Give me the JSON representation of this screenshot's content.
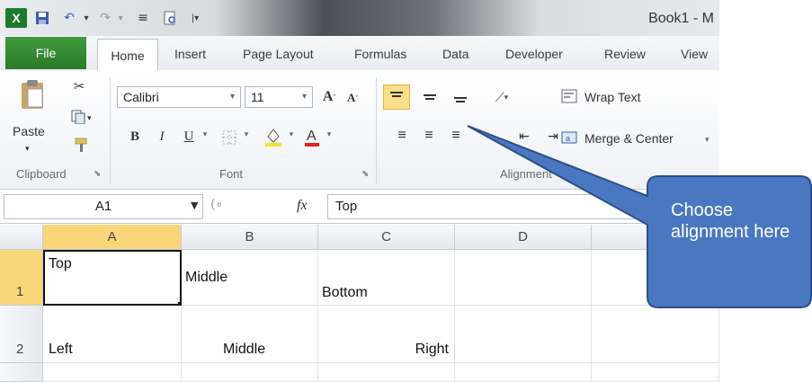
{
  "title_bar": {
    "title": "Book1 - M"
  },
  "tabs": [
    "File",
    "Home",
    "Insert",
    "Page Layout",
    "Formulas",
    "Data",
    "Developer",
    "Review",
    "View"
  ],
  "ribbon": {
    "clipboard": {
      "paste_label": "Paste",
      "group_label": "Clipboard"
    },
    "font": {
      "name": "Calibri",
      "size": "11",
      "group_label": "Font",
      "bold": "B",
      "italic": "I",
      "underline": "U"
    },
    "alignment": {
      "wrap_text": "Wrap Text",
      "merge_center": "Merge & Center",
      "group_label": "Alignment"
    }
  },
  "formula_bar": {
    "name_box": "A1",
    "fx": "fx",
    "content": "Top"
  },
  "grid": {
    "columns": [
      "A",
      "B",
      "C",
      "D"
    ],
    "rows": [
      "1",
      "2"
    ],
    "cells": {
      "A1": "Top",
      "B1": "Middle",
      "C1": "Bottom",
      "A2": "Left",
      "B2": "Middle",
      "C2": "Right"
    },
    "selected": "A1"
  },
  "callout": {
    "text": "Choose alignment here",
    "color": "#4a78c0"
  },
  "colors": {
    "file_tab": "#2e8a2c",
    "selected_col_header": "#f9d67a",
    "align_top_highlight": "#fbe08a"
  }
}
